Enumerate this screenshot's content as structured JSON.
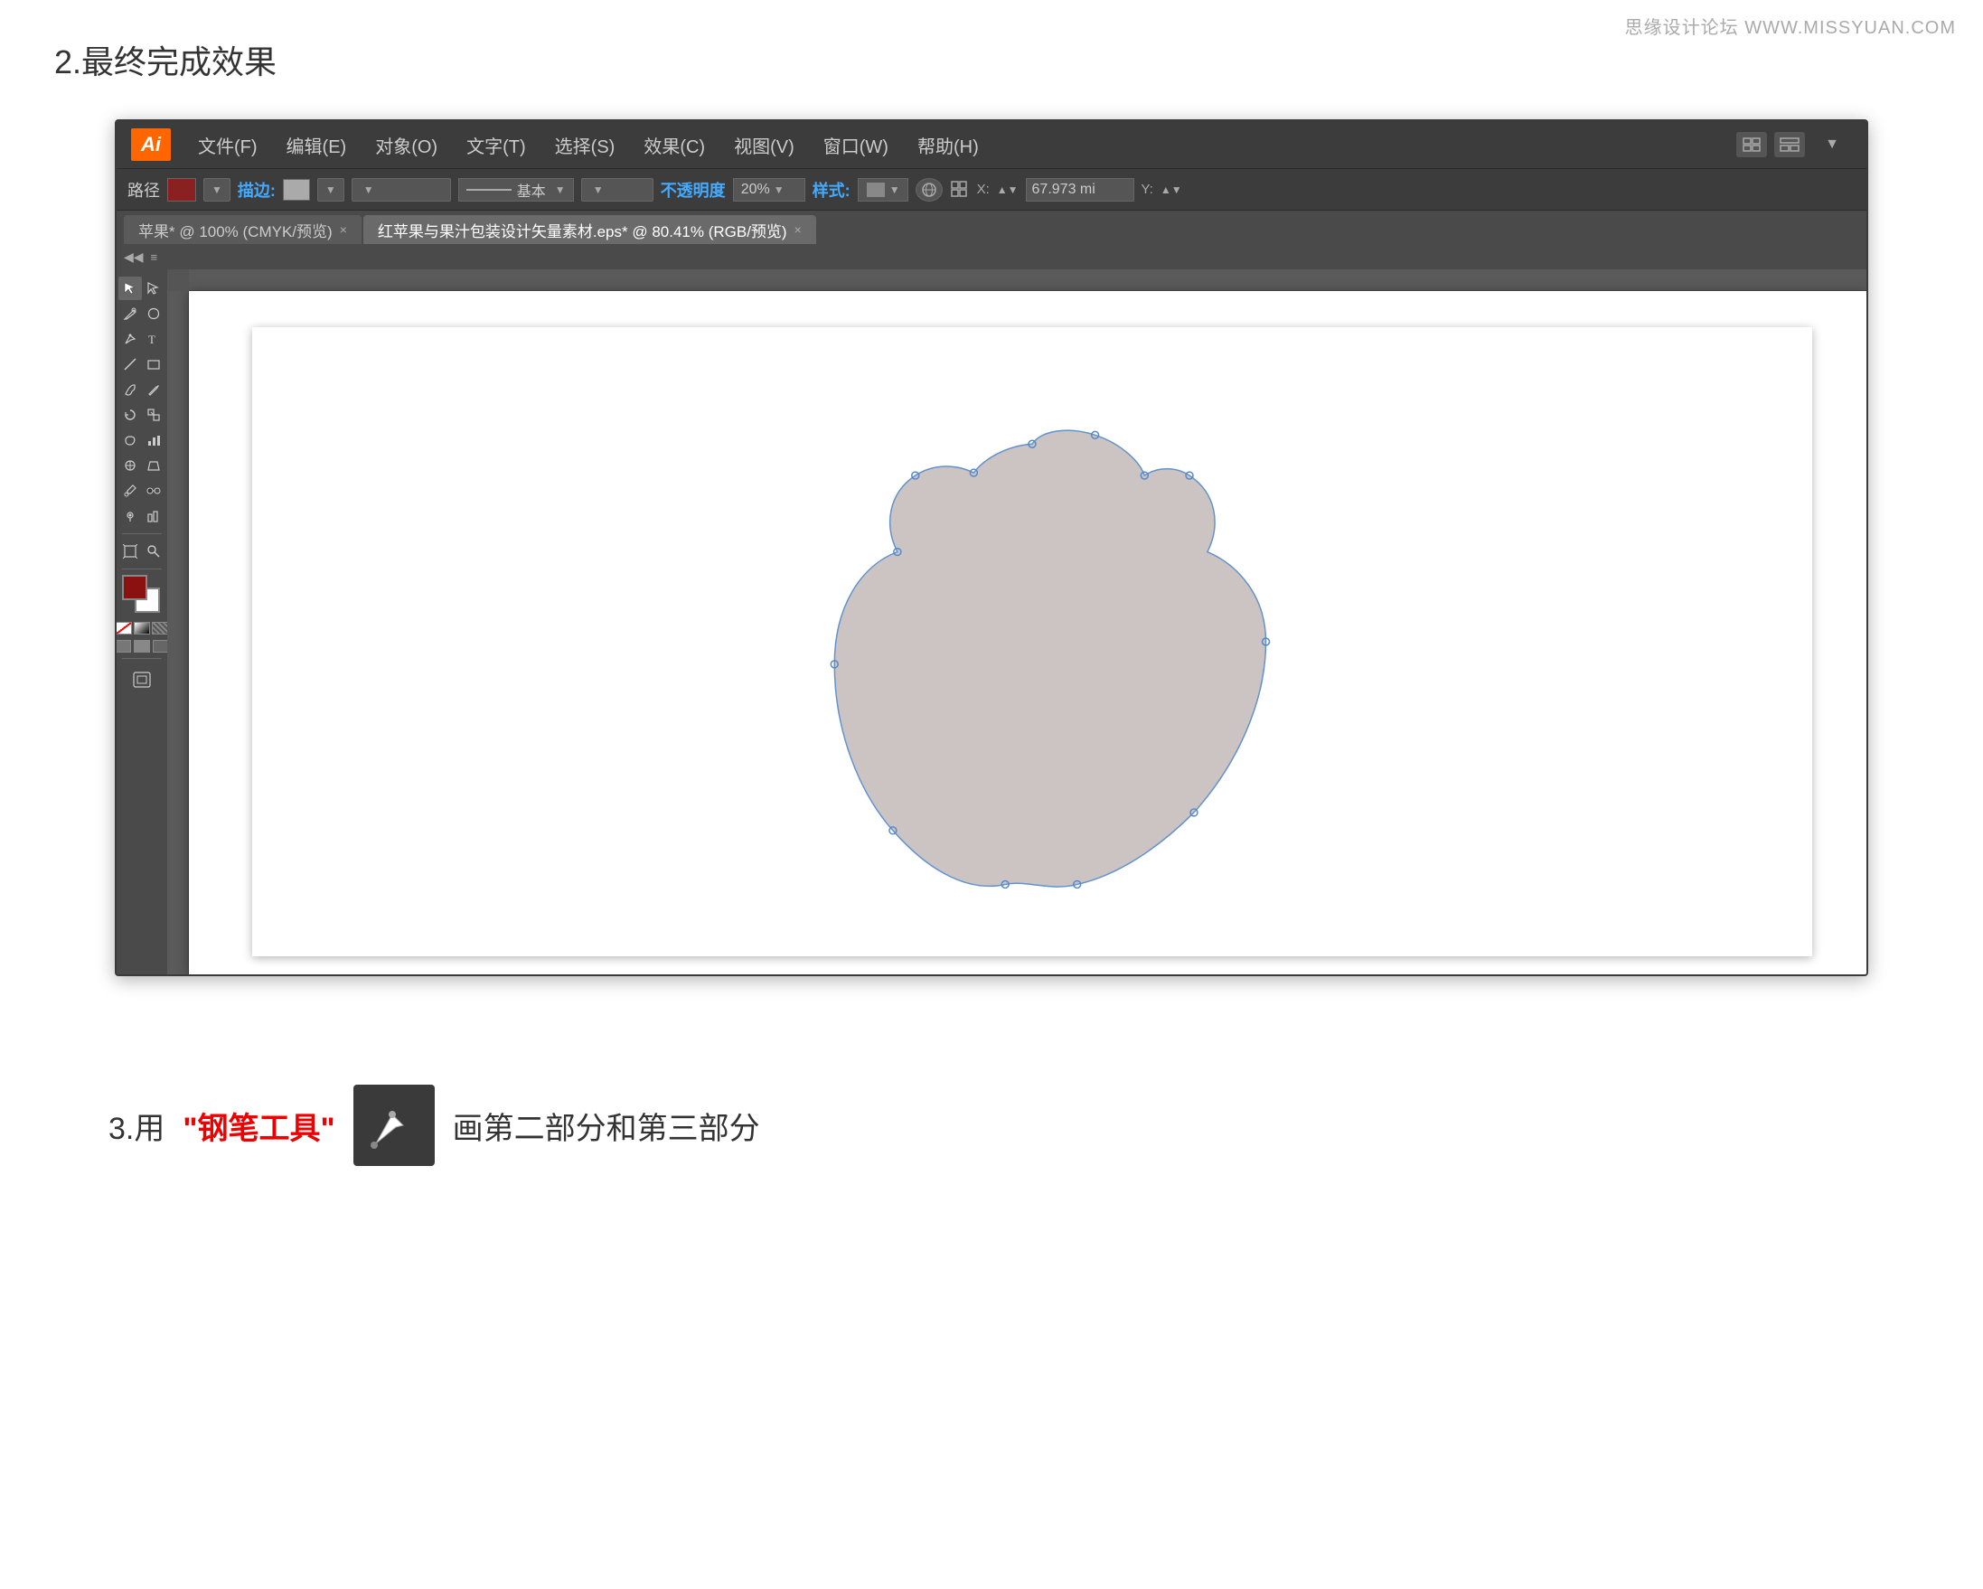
{
  "page": {
    "watermark": "思缘设计论坛 WWW.MISSYUAN.COM"
  },
  "section2": {
    "title": "2.最终完成效果"
  },
  "section3": {
    "prefix": "3.用",
    "highlight": "\"钢笔工具\"",
    "suffix": "画第二部分和第三部分"
  },
  "ai_window": {
    "logo": "Ai",
    "menu_items": [
      "文件(F)",
      "编辑(E)",
      "对象(O)",
      "文字(T)",
      "选择(S)",
      "效果(C)",
      "视图(V)",
      "窗口(W)",
      "帮助(H)"
    ],
    "tool_options": {
      "label": "路径",
      "stroke_label": "描边",
      "opacity_label": "不透明度",
      "opacity_value": "20%",
      "style_label": "样式:",
      "line_style": "基本",
      "coord_label": "X:",
      "coord_value": "67.973 mi"
    },
    "tabs": [
      {
        "label": "苹果* @ 100% (CMYK/预览)",
        "active": false
      },
      {
        "label": "红苹果与果汁包装设计矢量素材.eps* @ 80.41% (RGB/预览)",
        "active": true
      }
    ]
  }
}
